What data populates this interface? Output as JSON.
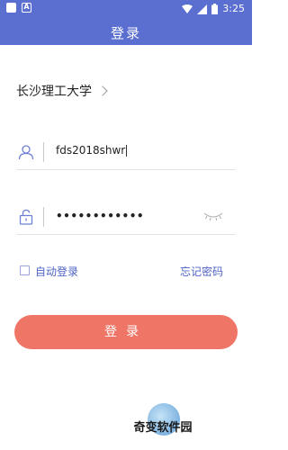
{
  "status_bar": {
    "time": "3:25"
  },
  "header": {
    "title": "登录"
  },
  "school": {
    "name": "长沙理工大学"
  },
  "username": {
    "value": "fds2018shwr"
  },
  "password": {
    "masked": "••••••••••••"
  },
  "options": {
    "auto_login": "自动登录",
    "forgot_password": "忘记密码"
  },
  "login_button": {
    "label": "登录"
  },
  "watermark": {
    "text": "奇变软件园"
  },
  "colors": {
    "primary": "#5a6fd0",
    "button": "#ef7566",
    "link": "#4f63c4"
  },
  "icons": [
    "wifi-icon",
    "signal-icon",
    "battery-icon",
    "user-icon",
    "lock-icon",
    "eye-closed-icon",
    "chevron-right-icon"
  ]
}
